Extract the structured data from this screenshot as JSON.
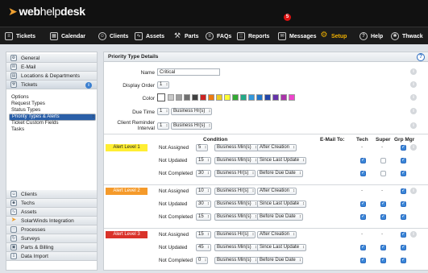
{
  "app": {
    "logo_prefix": "web",
    "logo_mid": "help",
    "logo_suffix": "desk"
  },
  "nav": {
    "items": [
      {
        "label": "Tickets",
        "icon": "list-icon"
      },
      {
        "label": "Calendar",
        "icon": "calendar-icon"
      },
      {
        "label": "Clients",
        "icon": "person-icon"
      },
      {
        "label": "Assets",
        "icon": "chart-icon"
      },
      {
        "label": "Parts",
        "icon": "wrench-icon"
      },
      {
        "label": "FAQs",
        "icon": "list-circle-icon"
      },
      {
        "label": "Reports",
        "icon": "report-icon"
      },
      {
        "label": "Messages",
        "icon": "envelope-icon"
      },
      {
        "label": "Setup",
        "icon": "gear-icon"
      },
      {
        "label": "Help",
        "icon": "question-icon"
      },
      {
        "label": "Thwack",
        "icon": "thwack-icon"
      }
    ],
    "messages_badge": "5"
  },
  "sidebar": {
    "top": [
      {
        "label": "General"
      },
      {
        "label": "E-Mail"
      },
      {
        "label": "Locations & Departments"
      },
      {
        "label": "Tickets"
      }
    ],
    "tickets_info": "i",
    "sub": [
      {
        "label": "Options"
      },
      {
        "label": "Request Types"
      },
      {
        "label": "Status Types"
      },
      {
        "label": "Priority Types & Alerts"
      },
      {
        "label": "Ticket Custom Fields"
      },
      {
        "label": "Tasks"
      }
    ],
    "bottom": [
      {
        "label": "Clients"
      },
      {
        "label": "Techs"
      },
      {
        "label": "Assets"
      },
      {
        "label": "SolarWinds Integration"
      },
      {
        "label": "Processes"
      },
      {
        "label": "Surveys"
      },
      {
        "label": "Parts & Billing"
      },
      {
        "label": "Data Import"
      }
    ]
  },
  "panel": {
    "title": "Priority Type Details",
    "help": "?",
    "name_label": "Name",
    "name_value": "Critical",
    "display_order_label": "Display Order",
    "display_order_value": "1",
    "color_label": "Color",
    "due_time_label": "Due Time",
    "due_time_num": "1",
    "due_time_unit": "Business Hr(s)",
    "reminder_label": "Client Reminder Interval",
    "reminder_num": "1",
    "reminder_unit": "Business Hr(s)",
    "info": "i",
    "colors": [
      "#ffffff",
      "#c8c8c8",
      "#a0a0a0",
      "#707070",
      "#404040",
      "#cc2222",
      "#ee7a11",
      "#eecc22",
      "#ffff33",
      "#33aa33",
      "#22aa88",
      "#3399dd",
      "#2277cc",
      "#2244aa",
      "#6633aa",
      "#aa33aa",
      "#ee44cc"
    ]
  },
  "table": {
    "headers": {
      "condition": "Condition",
      "email_to": "E-Mail To:",
      "tech": "Tech",
      "super": "Super",
      "grp_mgr": "Grp Mgr"
    },
    "alerts": [
      {
        "label": "Alert Level 1",
        "color": "#ffee33",
        "rows": [
          {
            "cond": "Not Assigned",
            "num": "5",
            "unit": "Business Min(s)",
            "when": "After Creation",
            "tech": "-",
            "super": "-",
            "grp": true
          },
          {
            "cond": "Not Updated",
            "num": "15",
            "unit": "Business Min(s)",
            "when": "Since Last Update",
            "tech": true,
            "super": false,
            "grp": true
          },
          {
            "cond": "Not Completed",
            "num": "30",
            "unit": "Business Hr(s)",
            "when": "Before Due Date",
            "tech": true,
            "super": false,
            "grp": true
          }
        ]
      },
      {
        "label": "Alert Level 2",
        "color": "#f59a2a",
        "rows": [
          {
            "cond": "Not Assigned",
            "num": "10",
            "unit": "Business Hr(s)",
            "when": "After Creation",
            "tech": "-",
            "super": "-",
            "grp": true
          },
          {
            "cond": "Not Updated",
            "num": "30",
            "unit": "Business Min(s)",
            "when": "Since Last Update",
            "tech": true,
            "super": true,
            "grp": true
          },
          {
            "cond": "Not Completed",
            "num": "15",
            "unit": "Business Min(s)",
            "when": "Before Due Date",
            "tech": true,
            "super": true,
            "grp": true
          }
        ]
      },
      {
        "label": "Alert Level 3",
        "color": "#d9332a",
        "rows": [
          {
            "cond": "Not Assigned",
            "num": "15",
            "unit": "Business Hr(s)",
            "when": "After Creation",
            "tech": "-",
            "super": "-",
            "grp": true
          },
          {
            "cond": "Not Updated",
            "num": "45",
            "unit": "Business Min(s)",
            "when": "Since Last Update",
            "tech": true,
            "super": true,
            "grp": true
          },
          {
            "cond": "Not Completed",
            "num": "0",
            "unit": "Business Min(s)",
            "when": "Before Due Date",
            "tech": true,
            "super": true,
            "grp": true
          }
        ]
      }
    ]
  }
}
